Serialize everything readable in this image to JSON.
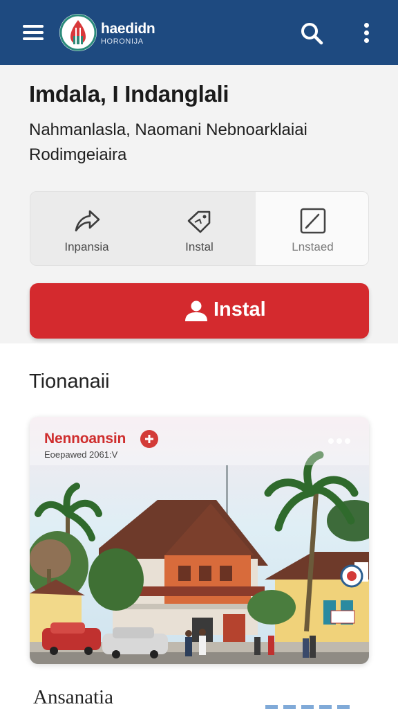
{
  "appbar": {
    "brand_name": "haedidn",
    "brand_sub": "HORONIJA",
    "menu_icon": "hamburger-menu-icon",
    "search_icon": "search-icon",
    "more_icon": "more-vertical-icon",
    "background_color": "#1e4a80"
  },
  "header": {
    "title": "Imdala, I Indanglali",
    "subtitle": "Nahmanlasla, Naomani Nebnoarklaiai Rodimgeiaira"
  },
  "tabs": [
    {
      "label": "Inpansia",
      "icon": "share-arrow-icon"
    },
    {
      "label": "Instal",
      "icon": "tag-icon"
    },
    {
      "label": "Lnstaed",
      "icon": "edit-box-icon"
    }
  ],
  "install_button": {
    "label": "Instal",
    "icon": "user-icon",
    "color": "#d42a2e"
  },
  "section": {
    "title": "Tionanaii"
  },
  "card": {
    "title": "Nennoansin",
    "subtitle": "Eoepawed 2061:V",
    "image": "building-with-palm-trees-photo",
    "more_icon": "more-horizontal-icon",
    "accent_color": "#cf2e2e"
  },
  "next_section": {
    "title": "Ansanatia"
  }
}
